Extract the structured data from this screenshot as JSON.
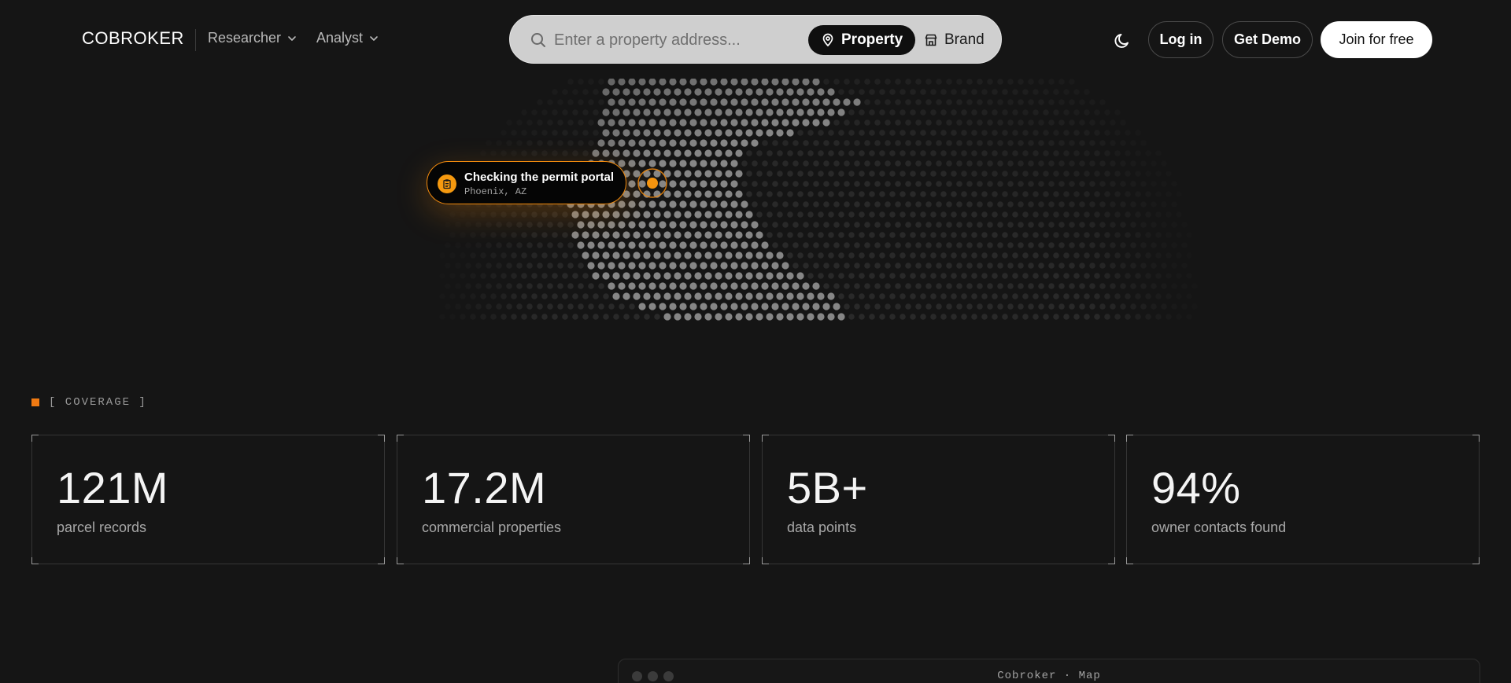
{
  "header": {
    "logo": "COBROKER",
    "nav": [
      {
        "label": "Researcher"
      },
      {
        "label": "Analyst"
      }
    ],
    "search": {
      "placeholder": "Enter a property address...",
      "modes": [
        {
          "label": "Property",
          "icon": "map-pin-icon",
          "selected": true
        },
        {
          "label": "Brand",
          "icon": "storefront-icon",
          "selected": false
        }
      ]
    },
    "actions": {
      "theme_icon": "moon-icon",
      "login": "Log in",
      "demo": "Get Demo",
      "join": "Join for free"
    }
  },
  "hero": {
    "callout": {
      "icon": "clipboard-icon",
      "title": "Checking the permit portal",
      "location": "Phoenix, AZ"
    }
  },
  "coverage": {
    "label": "[ COVERAGE ]",
    "stats": [
      {
        "value": "121M",
        "label": "parcel records"
      },
      {
        "value": "17.2M",
        "label": "commercial properties"
      },
      {
        "value": "5B+",
        "label": "data points"
      },
      {
        "value": "94%",
        "label": "owner contacts found"
      }
    ]
  },
  "map_window": {
    "title": "Cobroker · Map"
  },
  "colors": {
    "background": "#151515",
    "accent": "#f28a0d",
    "search_bg": "#cfcfcf",
    "card_border": "#353535"
  }
}
